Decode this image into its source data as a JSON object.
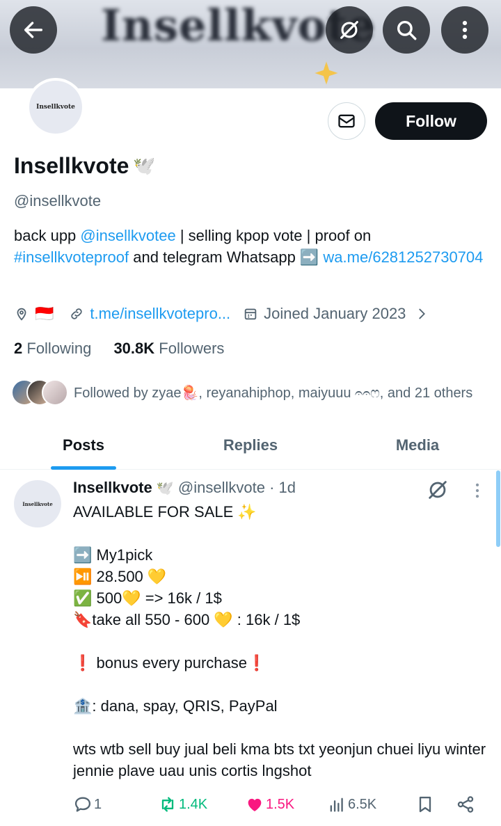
{
  "banner": {
    "text": "Insellkvote"
  },
  "top_bar": {
    "back_icon": "arrow-left-icon",
    "grok_icon": "slash-circle-icon",
    "search_icon": "search-icon",
    "more_icon": "more-vertical-icon"
  },
  "profile": {
    "avatar_text": "Insellkvote",
    "name": "Insellkvote",
    "name_emoji": "🕊️",
    "handle": "@insellkvote",
    "bio_prefix": "back upp ",
    "bio_mention": "@insellkvotee",
    "bio_middle": " | selling kpop vote | proof on ",
    "bio_hashtag": "#insellkvoteproof",
    "bio_after_hashtag": "  and telegram  Whatsapp ➡️ ",
    "bio_link": "wa.me/6281252730704",
    "location_flag": "🇮🇩",
    "website": "t.me/insellkvotepro...",
    "joined": "Joined January 2023",
    "following_count": "2",
    "following_label": "Following",
    "followers_count": "30.8K",
    "followers_label": "Followers",
    "followed_by": "Followed by zyae🪼, reyanahiphop, maiyuuu 𝄐𝄐ෆ, and 21 others",
    "follow_button": "Follow",
    "mail_icon": "mail-icon"
  },
  "tabs": [
    "Posts",
    "Replies",
    "Media"
  ],
  "active_tab": "Posts",
  "colors": {
    "accent": "#1d9bf0",
    "text": "#0f1419",
    "muted": "#536471",
    "retweet": "#00ba7c",
    "like": "#f91880"
  },
  "tweet": {
    "name": "Insellkvote",
    "name_emoji": "🕊️",
    "handle": "@insellkvote",
    "time": "· 1d",
    "body": "AVAILABLE FOR SALE ✨\n\n➡️ My1pick\n⏯️ 28.500 💛\n✅ 500💛 => 16k / 1$\n🔖take all 550 - 600 💛 : 16k / 1$\n\n❗ bonus every purchase❗\n\n🏦: dana, spay, QRIS, PayPal\n\nwts wtb sell buy jual beli kma bts txt yeonjun chuei liyu winter jennie plave uau unis cortis lngshot",
    "replies": "1",
    "retweets": "1.4K",
    "likes": "1.5K",
    "views": "6.5K"
  }
}
